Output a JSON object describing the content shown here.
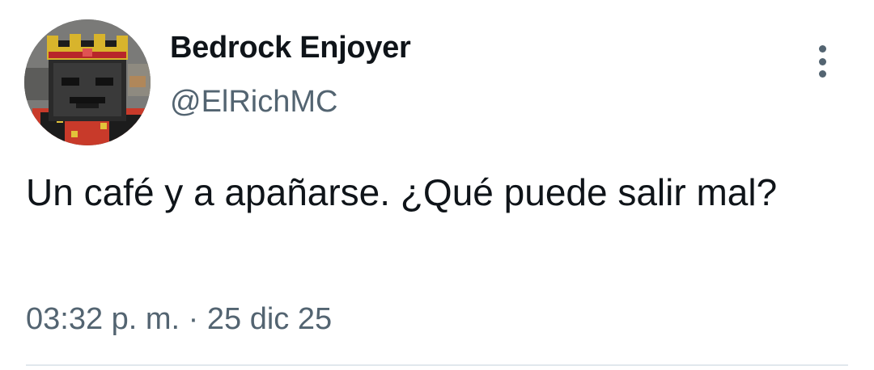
{
  "author": {
    "display_name": "Bedrock Enjoyer",
    "handle": "@ElRichMC",
    "avatar_icon": "minecraft-wither-skeleton-crowned-avatar"
  },
  "menu": {
    "icon": "more-vertical-icon"
  },
  "tweet": {
    "text": "Un café y a apañarse. ¿Qué puede salir mal?",
    "timestamp": "03:32 p. m. · 25 dic 25"
  },
  "colors": {
    "primary_text": "#0f1419",
    "secondary_text": "#536471",
    "divider": "#e1e8ed",
    "background": "#ffffff"
  }
}
